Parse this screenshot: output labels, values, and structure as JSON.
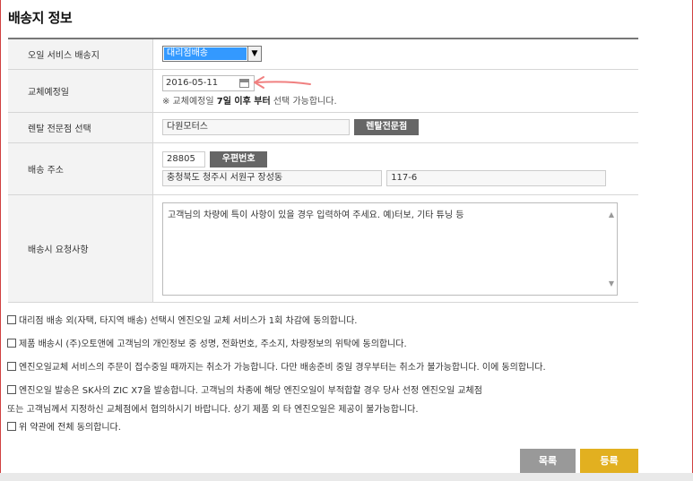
{
  "page": {
    "title": "배송지 정보"
  },
  "form": {
    "service": {
      "label": "오일 서비스 배송지",
      "selected": "대리점배송"
    },
    "exchange_date": {
      "label": "교체예정일",
      "value": "2016-05-11",
      "note_prefix": "※ 교체예정일",
      "note_bold": "7일 이후 부터",
      "note_suffix": "선택 가능합니다."
    },
    "rental_shop": {
      "label": "렌탈 전문점 선택",
      "value": "다원모터스",
      "button": "렌탈전문점"
    },
    "address": {
      "label": "배송 주소",
      "postcode": "28805",
      "postcode_button": "우편번호",
      "address1": "충청북도 청주시 서원구 장성동",
      "address2": "117-6"
    },
    "request": {
      "label": "배송시 요청사항",
      "text": "고객님의 차량에 특이 사항이 있을 경우 입력하여 주세요. 예)터보, 기타 튜닝 등"
    }
  },
  "agreements": [
    "대리점 배송 외(자택, 타지역 배송) 선택시 엔진오일 교체 서비스가 1회 차감에 동의합니다.",
    "제품 배송시 (주)오토앤에 고객님의 개인정보 중 성명, 전화번호, 주소지, 차량정보의 위탁에 동의합니다.",
    "엔진오일교체 서비스의 주문이 접수중일 때까지는 취소가 가능합니다. 다만 배송준비 중일 경우부터는 취소가 불가능합니다. 이에 동의합니다.",
    "엔진오일 발송은 SK사의 ZIC X7을 발송합니다. 고객님의 차종에 해당 엔진오일이 부적합할 경우 당사 선정 엔진오일 교체점",
    "또는 고객님께서 지정하신 교체점에서 협의하시기 바랍니다. 상기 제품 외 타 엔진오일은 제공이 불가능합니다.",
    "위 약관에 전체 동의합니다."
  ],
  "buttons": {
    "list": "목록",
    "submit": "등록"
  },
  "colors": {
    "submit": "#e2b020",
    "list": "#999999",
    "select_highlight": "#3399ff"
  }
}
